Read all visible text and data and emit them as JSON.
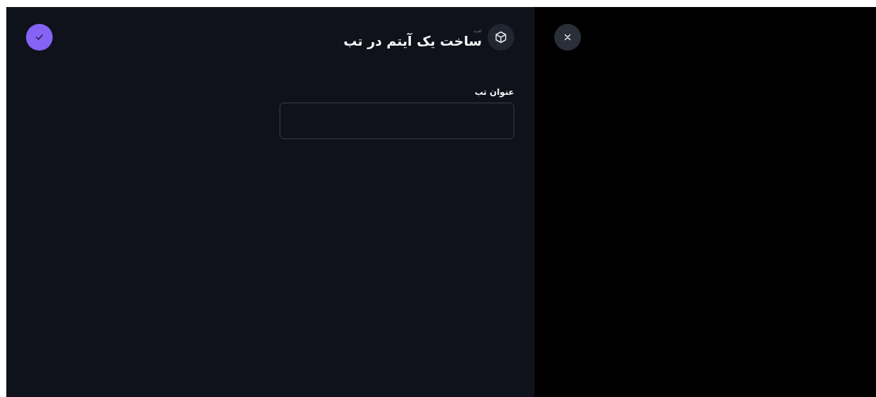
{
  "header": {
    "subtitle": "تب",
    "title": "ساخت یک آیتم در تب"
  },
  "form": {
    "fields": [
      {
        "label": "عنوان تب"
      }
    ]
  }
}
